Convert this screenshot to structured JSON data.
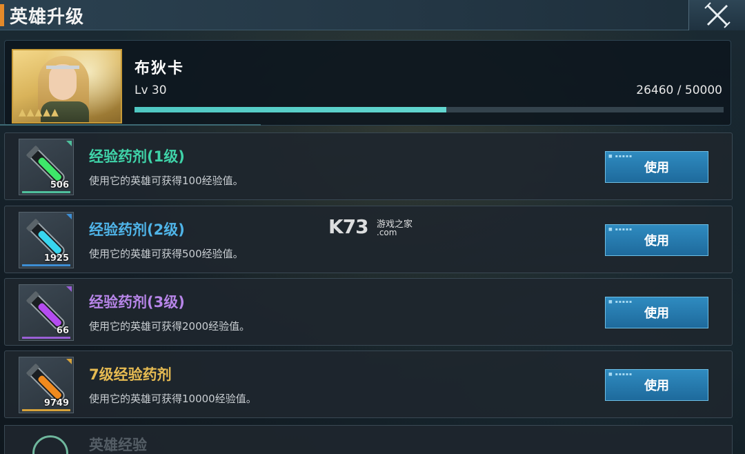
{
  "header": {
    "title": "英雄升级"
  },
  "hero": {
    "name": "布狄卡",
    "level": "Lv 30",
    "exp_text": "26460 / 50000",
    "exp_progress": 0.529
  },
  "items": [
    {
      "name": "经验药剂(1级)",
      "desc": "使用它的英雄可获得100经验值。",
      "count": "506",
      "button": "使用",
      "color": "#3fd3a8",
      "rarity_color": "#4fbf9c",
      "liquid": "#3ee66a"
    },
    {
      "name": "经验药剂(2级)",
      "desc": "使用它的英雄可获得500经验值。",
      "count": "1925",
      "button": "使用",
      "color": "#4fb4e8",
      "rarity_color": "#3d8ed4",
      "liquid": "#38d6ef"
    },
    {
      "name": "经验药剂(3级)",
      "desc": "使用它的英雄可获得2000经验值。",
      "count": "66",
      "button": "使用",
      "color": "#b785e8",
      "rarity_color": "#9a5fd6",
      "liquid": "#b44cf0"
    },
    {
      "name": "7级经验药剂",
      "desc": "使用它的英雄可获得10000经验值。",
      "count": "9749",
      "button": "使用",
      "color": "#e6bb52",
      "rarity_color": "#d6a23a",
      "liquid": "#f08a1e"
    }
  ],
  "partial_item": {
    "name": "英雄经验"
  },
  "watermark": {
    "logo": "K73",
    "text": "游戏之家",
    "domain": ".com"
  }
}
